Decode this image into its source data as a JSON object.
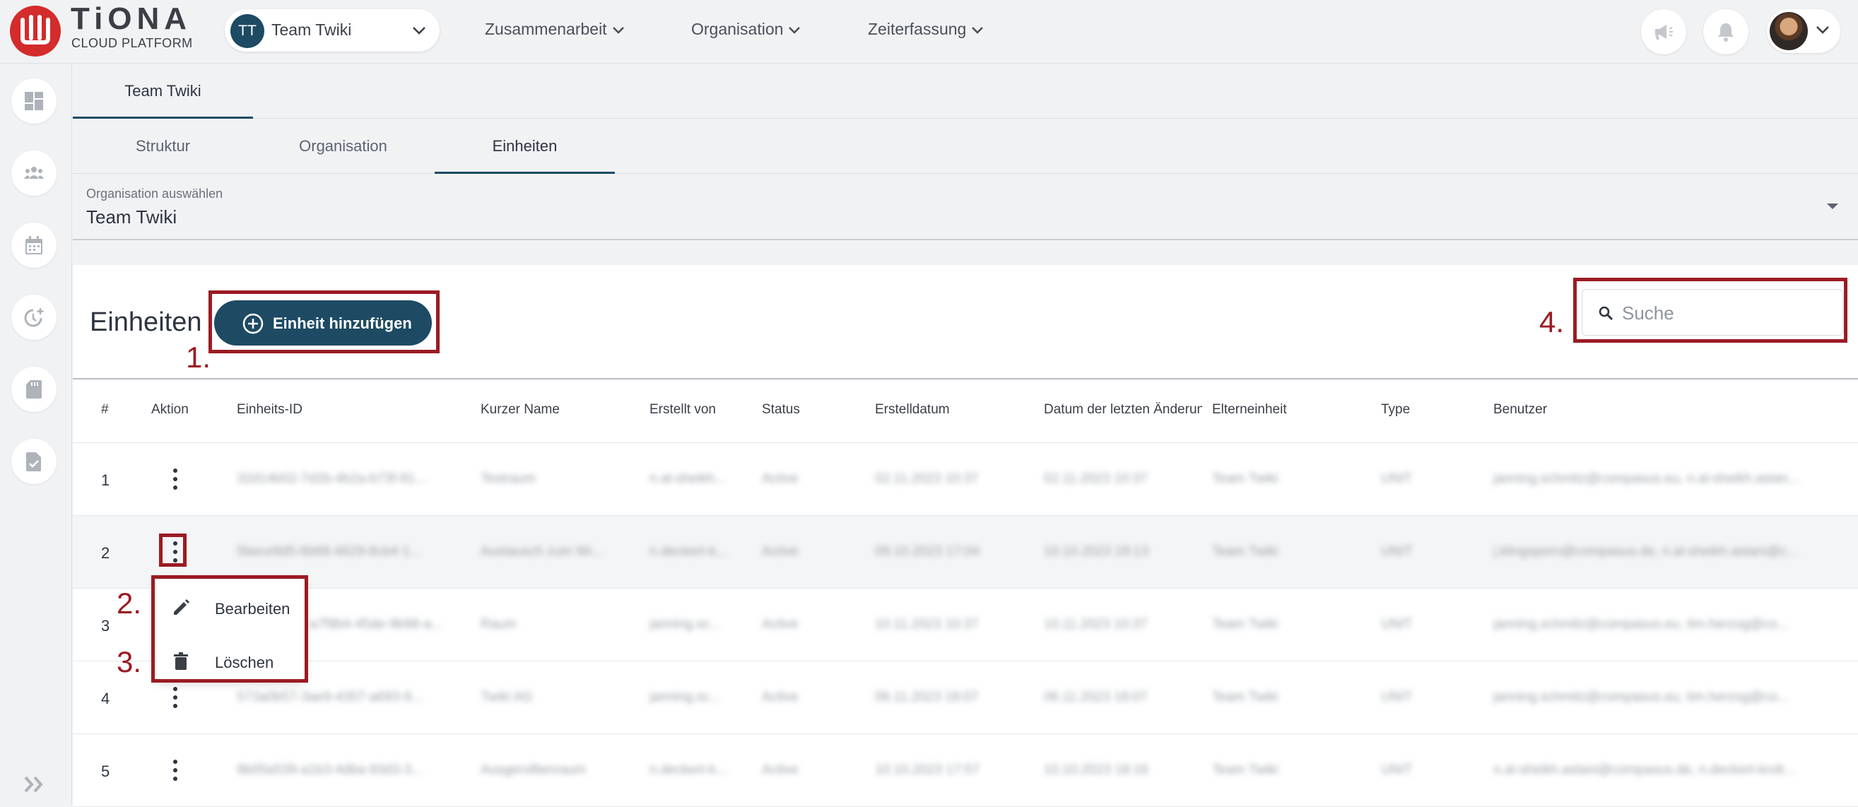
{
  "brand": {
    "name": "TiONA",
    "subtitle": "CLOUD PLATFORM",
    "color": "#d42b2b"
  },
  "team_switcher": {
    "initials": "TT",
    "name": "Team Twiki"
  },
  "nav": [
    {
      "label": "Zusammenarbeit"
    },
    {
      "label": "Organisation"
    },
    {
      "label": "Zeiterfassung"
    }
  ],
  "top_icons": [
    "megaphone-icon",
    "bell-icon",
    "user-avatar"
  ],
  "sidebar_icons": [
    "dashboard-icon",
    "people-icon",
    "calendar-icon",
    "timer-plus-icon",
    "sd-card-icon",
    "file-check-icon",
    "double-chevron-right-icon"
  ],
  "tabs_level1": [
    {
      "label": "Team Twiki",
      "active": true
    }
  ],
  "tabs_level2": [
    {
      "label": "Struktur",
      "active": false
    },
    {
      "label": "Organisation",
      "active": false
    },
    {
      "label": "Einheiten",
      "active": true
    }
  ],
  "org_select": {
    "label": "Organisation auswählen",
    "value": "Team Twiki"
  },
  "card": {
    "title": "Einheiten",
    "add_button": "Einheit hinzufügen",
    "search_placeholder": "Suche"
  },
  "annotations": [
    "1.",
    "2.",
    "3.",
    "4."
  ],
  "table": {
    "columns": [
      "#",
      "Aktion",
      "Einheits-ID",
      "Kurzer Name",
      "Erstellt von",
      "Status",
      "Erstelldatum",
      "Datum der letzten Änderung",
      "Elterneinheit",
      "Type",
      "Benutzer"
    ],
    "rows": [
      {
        "index": "1",
        "id": "32d14b02-7d2b-4b2a-b73f-81...",
        "short": "Testraum",
        "created_by": "n.al-sheikh...",
        "status": "Active",
        "created": "02.11.2023 10:37",
        "changed": "02.11.2023 10:37",
        "parent": "Team Twiki",
        "type": "UNIT",
        "users": "janning.schmitz@compasus.eu, n.al-sheikh.astan..."
      },
      {
        "index": "2",
        "id": "5bece9d5-6b68-4629-8cb4-1...",
        "short": "Austausch zum Wi...",
        "created_by": "n.deckert-k...",
        "status": "Active",
        "created": "09.10.2023 17:04",
        "changed": "10.10.2023 18:13",
        "parent": "Team Twiki",
        "type": "UNIT",
        "users": "j.klingsporn@compasus.de, n.al-sheikh.astani@c..."
      },
      {
        "index": "3",
        "id": "a7f9b4-45de-9b98-a...",
        "short": "Raum",
        "created_by": "janning.sc...",
        "status": "Active",
        "created": "10.11.2023 10:37",
        "changed": "10.11.2023 10:37",
        "parent": "Team Twiki",
        "type": "UNIT",
        "users": "janning.schmitz@compasus.eu, tim.herzog@co..."
      },
      {
        "index": "4",
        "id": "573a0b57-3ae9-4357-a693-9...",
        "short": "Twiki AG",
        "created_by": "janning.sc...",
        "status": "Active",
        "created": "06.11.2023 18:07",
        "changed": "06.11.2023 18:07",
        "parent": "Team Twiki",
        "type": "UNIT",
        "users": "janning.schmitz@compasus.eu, tim.herzog@co..."
      },
      {
        "index": "5",
        "id": "9b05a539-a1b3-4dba-93d3-3...",
        "short": "Ausgerolltenraum",
        "created_by": "n.deckert-k...",
        "status": "Active",
        "created": "10.10.2023 17:57",
        "changed": "10.10.2023 18:16",
        "parent": "Team Twiki",
        "type": "UNIT",
        "users": "n.al-sheikh.astani@compasus.de, n.deckert-krolt..."
      }
    ]
  },
  "row_menu": {
    "edit": "Bearbeiten",
    "delete": "Löschen"
  },
  "colors": {
    "primary": "#1e4a63",
    "annotation": "#9b1b23"
  }
}
